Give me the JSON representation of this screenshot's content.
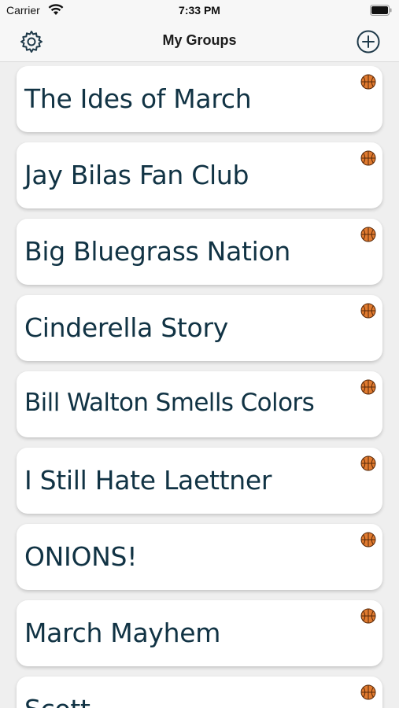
{
  "status_bar": {
    "carrier": "Carrier",
    "time": "7:33 PM"
  },
  "nav": {
    "title": "My Groups",
    "left_icon": "gear-icon",
    "right_icon": "plus-circle-icon"
  },
  "colors": {
    "text": "#113344",
    "icon": "#1f3a4a",
    "ball": "#e07a2f"
  },
  "groups": [
    {
      "name": "The Ides of March",
      "icon": "basketball-icon"
    },
    {
      "name": "Jay Bilas Fan Club",
      "icon": "basketball-icon"
    },
    {
      "name": "Big Bluegrass Nation",
      "icon": "basketball-icon"
    },
    {
      "name": "Cinderella Story",
      "icon": "basketball-icon"
    },
    {
      "name": "Bill Walton Smells Colors",
      "icon": "basketball-icon"
    },
    {
      "name": "I Still Hate Laettner",
      "icon": "basketball-icon"
    },
    {
      "name": "ONIONS!",
      "icon": "basketball-icon"
    },
    {
      "name": "March Mayhem",
      "icon": "basketball-icon"
    },
    {
      "name": "Scott",
      "icon": "basketball-icon"
    }
  ]
}
